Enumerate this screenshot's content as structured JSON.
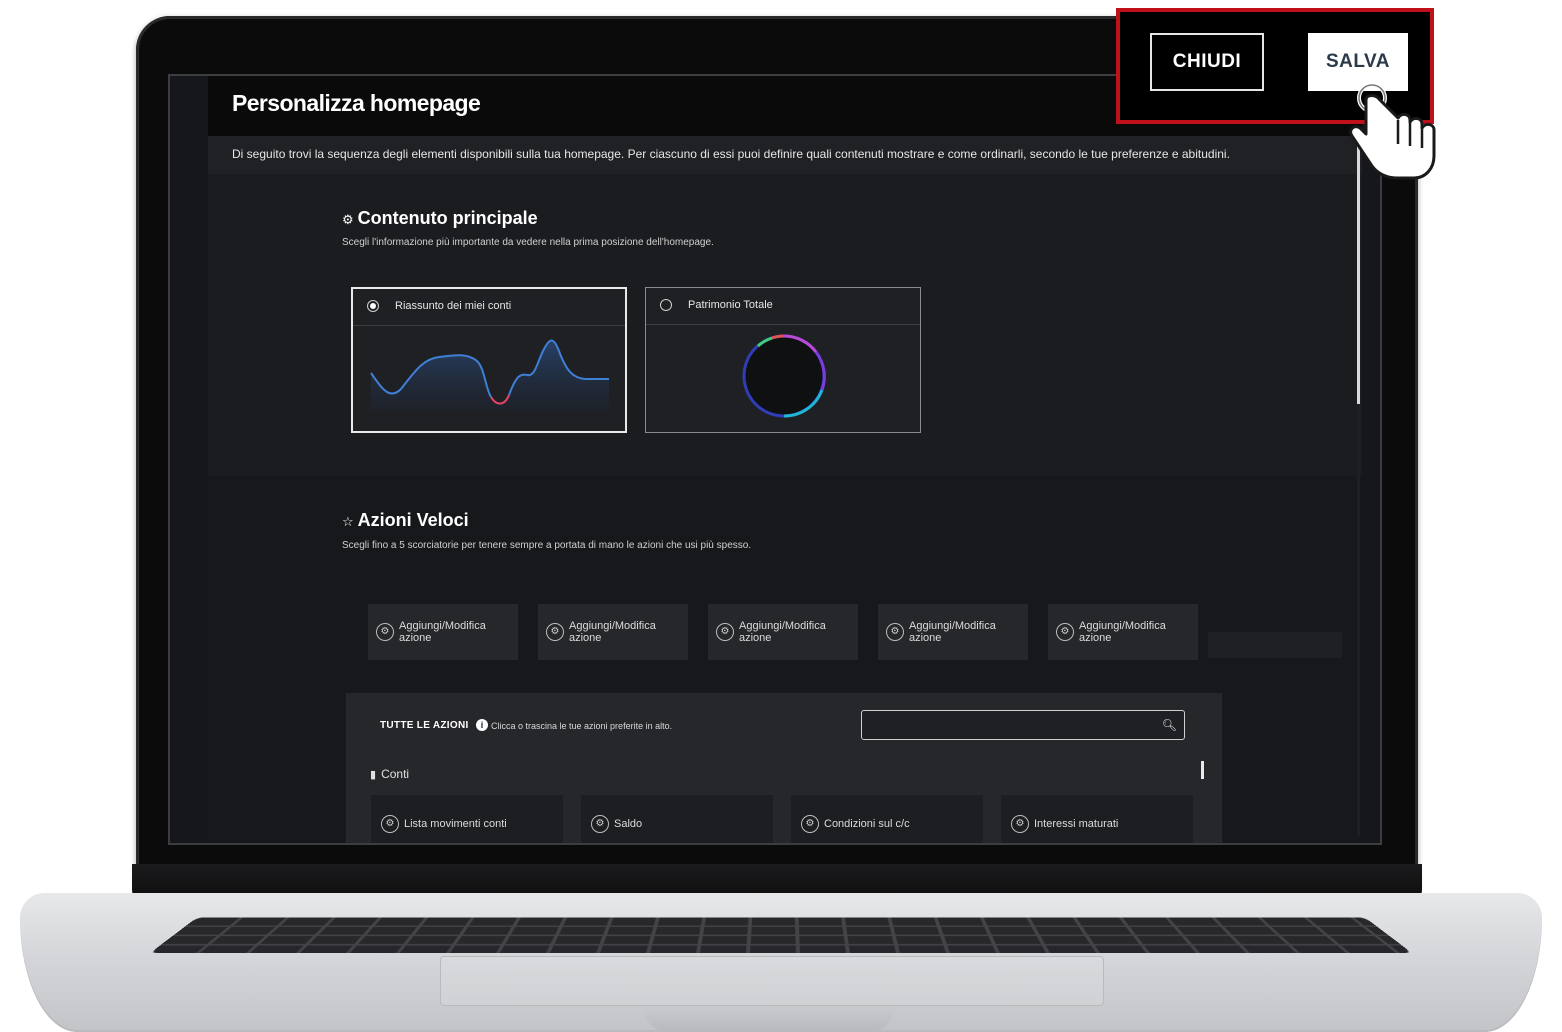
{
  "header": {
    "title": "Personalizza homepage",
    "intro": "Di seguito trovi la sequenza degli elementi disponibili sulla tua homepage. Per ciascuno di essi puoi definire quali contenuti mostrare e come ordinarli, secondo le tue preferenze e abitudini."
  },
  "buttons": {
    "close": "CHIUDI",
    "save": "SALVA"
  },
  "main_content": {
    "icon": "⚙",
    "title": "Contenuto principale",
    "subtitle": "Scegli l'informazione più importante da vedere nella prima posizione dell'homepage.",
    "options": [
      {
        "label": "Riassunto dei miei conti",
        "selected": true
      },
      {
        "label": "Patrimonio Totale",
        "selected": false
      }
    ]
  },
  "quick_actions": {
    "icon": "☆",
    "title": "Azioni Veloci",
    "subtitle": "Scegli fino a 5 scorciatorie per tenere sempre a portata di mano le azioni che usi più spesso.",
    "slots": [
      "Aggiungi/Modifica azione",
      "Aggiungi/Modifica azione",
      "Aggiungi/Modifica azione",
      "Aggiungi/Modifica azione",
      "Aggiungi/Modifica azione"
    ]
  },
  "all_actions": {
    "label": "TUTTE LE AZIONI",
    "info_icon": "i",
    "hint": "Clicca o trascina le tue azioni preferite in alto.",
    "search_placeholder": "",
    "group_label": "Conti",
    "items": [
      "Lista movimenti conti",
      "Saldo",
      "Condizioni sul c/c",
      "Interessi maturati"
    ]
  },
  "colors": {
    "highlight": "#c0111a",
    "chart_line": "#3f7fd6",
    "chart_accent": "#e8436a"
  }
}
